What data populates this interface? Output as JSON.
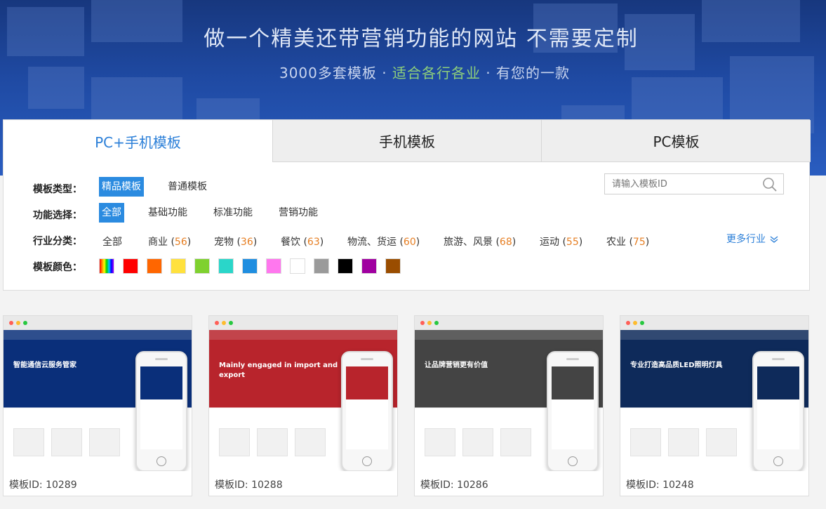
{
  "hero": {
    "title": "做一个精美还带营销功能的网站  不需要定制",
    "sub_a": "3000多套模板 · ",
    "sub_b": "适合各行各业",
    "sub_c": " · 有您的一款"
  },
  "tabs": [
    {
      "label": "PC+手机模板",
      "active": true
    },
    {
      "label": "手机模板",
      "active": false
    },
    {
      "label": "PC模板",
      "active": false
    }
  ],
  "filters": {
    "type_label": "模板类型：",
    "type_options": [
      "精品模板",
      "普通模板"
    ],
    "func_label": "功能选择：",
    "func_options": [
      "全部",
      "基础功能",
      "标准功能",
      "营销功能"
    ],
    "industry_label": "行业分类：",
    "industry_options": [
      {
        "name": "全部",
        "count": ""
      },
      {
        "name": "商业",
        "count": "56"
      },
      {
        "name": "宠物",
        "count": "36"
      },
      {
        "name": "餐饮",
        "count": "63"
      },
      {
        "name": "物流、货运",
        "count": "60"
      },
      {
        "name": "旅游、风景",
        "count": "68"
      },
      {
        "name": "运动",
        "count": "55"
      },
      {
        "name": "农业",
        "count": "75"
      }
    ],
    "more_label": "更多行业",
    "color_label": "模板颜色：",
    "colors": [
      "rainbow",
      "#ff0000",
      "#ff6600",
      "#ffe13d",
      "#7fd12f",
      "#2ad6c9",
      "#1f8ee0",
      "#ff77ee",
      "#ffffff",
      "#9a9a9a",
      "#000000",
      "#a000a0",
      "#9a4d00"
    ]
  },
  "search": {
    "placeholder": "请输入模板ID"
  },
  "cards": [
    {
      "caption": "模板ID: 10289",
      "banner": "智能通信云服务管家",
      "theme": "#0a2f7a"
    },
    {
      "caption": "模板ID: 10288",
      "banner": "Mainly engaged in import and export",
      "theme": "#b8242c"
    },
    {
      "caption": "模板ID: 10286",
      "banner": "让品牌营销更有价值",
      "theme": "#444444"
    },
    {
      "caption": "模板ID: 10248",
      "banner": "专业打造高品质LED照明灯具",
      "theme": "#0e2a5a"
    }
  ]
}
